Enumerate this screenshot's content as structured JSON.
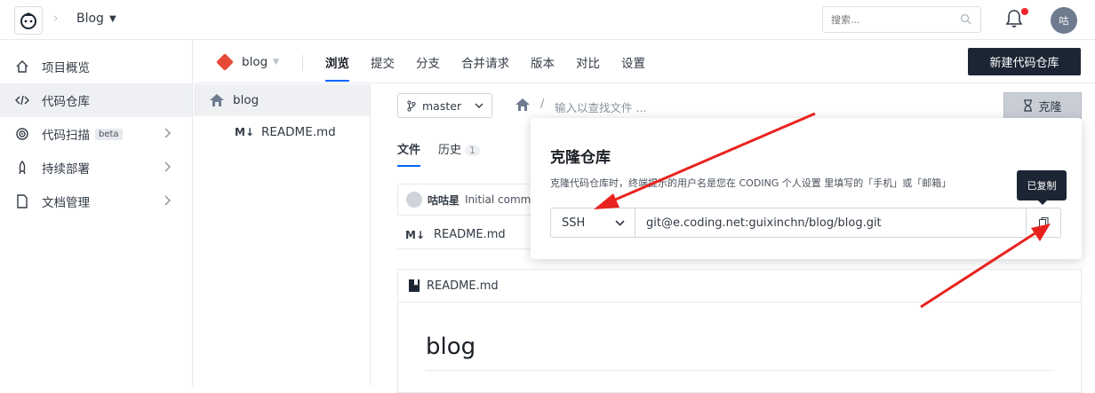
{
  "header": {
    "project": "Blog",
    "search_placeholder": "搜索...",
    "avatar_text": "咕",
    "notification_dot_color": "#f5222d"
  },
  "sidebar": {
    "items": [
      {
        "label": "项目概览",
        "icon": "home-icon"
      },
      {
        "label": "代码仓库",
        "icon": "code-icon",
        "active": true
      },
      {
        "label": "代码扫描",
        "badge": "beta",
        "icon": "scan-icon"
      },
      {
        "label": "持续部署",
        "icon": "rocket-icon"
      },
      {
        "label": "文档管理",
        "icon": "document-icon"
      }
    ]
  },
  "subnav": {
    "repo_name": "blog",
    "tabs": [
      "浏览",
      "提交",
      "分支",
      "合并请求",
      "版本",
      "对比",
      "设置"
    ],
    "active_tab": "浏览",
    "new_repo_label": "新建代码仓库"
  },
  "tree": {
    "root": "blog",
    "files": [
      "README.md"
    ]
  },
  "main": {
    "branch": "master",
    "path_placeholder": "输入以查找文件 ...",
    "clone_label": "克隆",
    "file_tabs": [
      {
        "label": "文件"
      },
      {
        "label": "历史",
        "count": "1"
      }
    ],
    "commit_author": "咕咕星",
    "commit_message": "Initial comm",
    "file_row": "README.md",
    "readme_header": "README.md",
    "readme_title": "blog"
  },
  "clone_popup": {
    "title": "克隆仓库",
    "description": "克隆代码仓库时，终端提示的用户名是您在 CODING 个人设置 里填写的「手机」或「邮箱」",
    "protocol": "SSH",
    "url": "git@e.coding.net:guixinchn/blog/blog.git",
    "tooltip": "已复制"
  },
  "colors": {
    "accent": "#0066ff",
    "dark_button": "#1c2533",
    "annotation_arrow": "#e8231f"
  }
}
